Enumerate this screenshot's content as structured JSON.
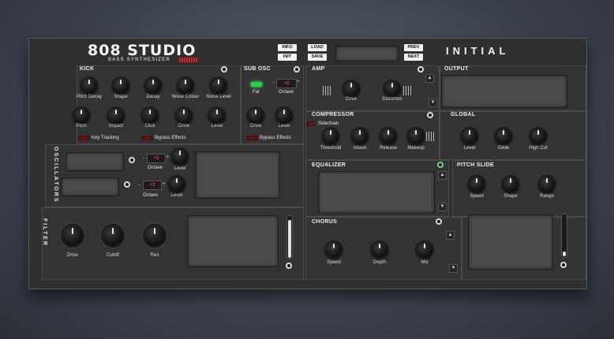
{
  "header": {
    "logo_main": "808 STUDIO",
    "logo_sub": "BASS SYNTHESIZER",
    "buttons": {
      "info": "INFO",
      "load": "LOAD",
      "init": "INIT",
      "save": "SAVE",
      "prev": "PREV",
      "next": "NEXT"
    },
    "preset_name": "INITIAL"
  },
  "kick": {
    "title": "KICK",
    "knobs_row1": [
      "Pitch Decay",
      "Shape",
      "Decay",
      "Noise Colour",
      "Noise Level"
    ],
    "knobs_row2": [
      "Pitch",
      "Impact",
      "Click",
      "Drive",
      "Level"
    ],
    "key_tracking": "Key Tracking",
    "bypass": "Bypass Effects"
  },
  "sub_osc": {
    "title": "SUB OSC",
    "fat": "Fat",
    "octave_label": "Octave",
    "octave_value": "+2",
    "drive": "Drive",
    "level": "Level",
    "bypass": "Bypass Effects"
  },
  "oscillators": {
    "side_label": "OSCILLATORS",
    "osc1": {
      "octave_label": "Octave",
      "octave_value": "+2",
      "level": "Level"
    },
    "osc2": {
      "octave_label": "Octave",
      "octave_value": "+2",
      "level": "Level"
    }
  },
  "filter": {
    "side_label": "FILTER",
    "knobs": [
      "Drive",
      "Cutoff",
      "Res"
    ]
  },
  "amp": {
    "title": "AMP",
    "knobs": [
      "Drive",
      "Distortion"
    ]
  },
  "compressor": {
    "title": "COMPRESSOR",
    "sidechain": "Sidechain",
    "knobs": [
      "Threshold",
      "Attack",
      "Release",
      "Makeup"
    ]
  },
  "equalizer": {
    "title": "EQUALIZER"
  },
  "chorus": {
    "title": "CHORUS",
    "knobs": [
      "Speed",
      "Depth",
      "Mix"
    ]
  },
  "output": {
    "title": "OUTPUT"
  },
  "global": {
    "title": "GLOBAL",
    "knobs": [
      "Level",
      "Glide",
      "High Cut"
    ]
  },
  "pitch_slide": {
    "title": "PITCH SLIDE",
    "knobs": [
      "Speed",
      "Shape",
      "Range"
    ]
  },
  "icons": {
    "arrow_up": "▲",
    "arrow_down": "▼",
    "minus": "-",
    "plus": "+"
  }
}
